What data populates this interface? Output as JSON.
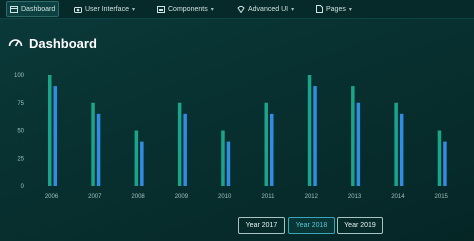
{
  "nav": {
    "items": [
      {
        "label": "Dashboard",
        "icon": "dashboard-icon",
        "active": true
      },
      {
        "label": "User Interface",
        "icon": "camera-icon",
        "caret": true
      },
      {
        "label": "Components",
        "icon": "calendar-icon",
        "caret": true
      },
      {
        "label": "Advanced UI",
        "icon": "diamond-icon",
        "caret": true
      },
      {
        "label": "Pages",
        "icon": "page-icon",
        "caret": true
      }
    ]
  },
  "page": {
    "title": "Dashboard",
    "icon": "speedometer-icon"
  },
  "year_buttons": [
    {
      "label": "Year 2017",
      "selected": false
    },
    {
      "label": "Year 2018",
      "selected": true
    },
    {
      "label": "Year 2019",
      "selected": false
    }
  ],
  "colors": {
    "series_a": "#1aa58a",
    "series_b": "#2f8de4",
    "accent": "#3aa6b8"
  },
  "chart_data": {
    "type": "bar",
    "categories": [
      "2006",
      "2007",
      "2008",
      "2009",
      "2010",
      "2011",
      "2012",
      "2013",
      "2014",
      "2015"
    ],
    "series": [
      {
        "values": [
          100,
          75,
          50,
          75,
          50,
          75,
          100,
          90,
          75,
          50
        ]
      },
      {
        "values": [
          90,
          65,
          40,
          65,
          40,
          65,
          90,
          75,
          65,
          40
        ]
      }
    ],
    "yticks": [
      0,
      25,
      50,
      75,
      100
    ],
    "ylim": [
      0,
      100
    ],
    "grid": false,
    "title": "",
    "xlabel": "",
    "ylabel": ""
  }
}
